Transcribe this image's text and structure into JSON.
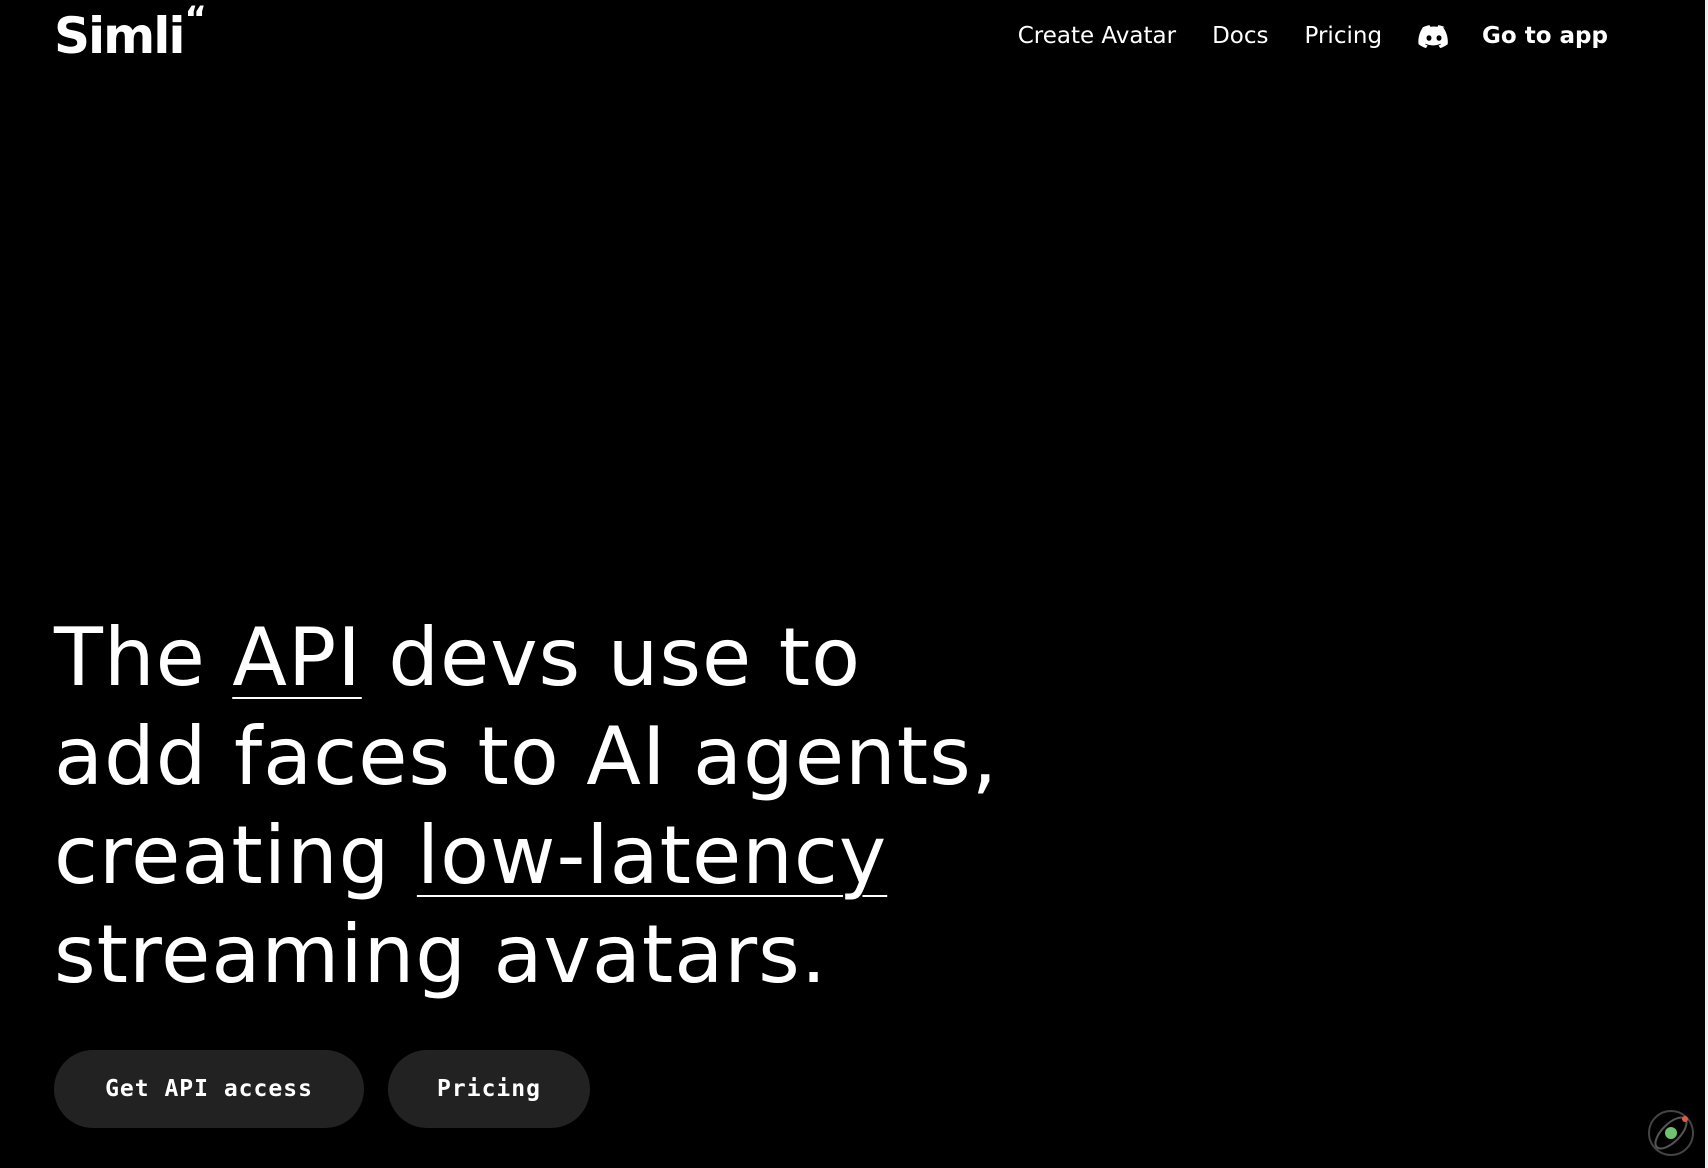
{
  "header": {
    "logo": {
      "text": "Simli",
      "quote_mark": "“"
    },
    "nav": {
      "create_avatar": "Create Avatar",
      "docs": "Docs",
      "pricing": "Pricing",
      "discord_icon": "discord-icon",
      "go_to_app": "Go to app"
    }
  },
  "hero": {
    "line1": {
      "before": "The ",
      "highlight": "API",
      "after": " devs use to"
    },
    "line2": "add faces to AI agents,",
    "line3": {
      "before": "creating ",
      "highlight": "low-latency"
    },
    "line4": "streaming avatars."
  },
  "buttons": {
    "primary": "Get API access",
    "secondary": "Pricing"
  },
  "widget": {
    "icon": "orbit-widget-icon"
  },
  "colors": {
    "background": "#000000",
    "text": "#ffffff",
    "button_bg": "#222222",
    "widget_accent": "#6fc26f"
  }
}
